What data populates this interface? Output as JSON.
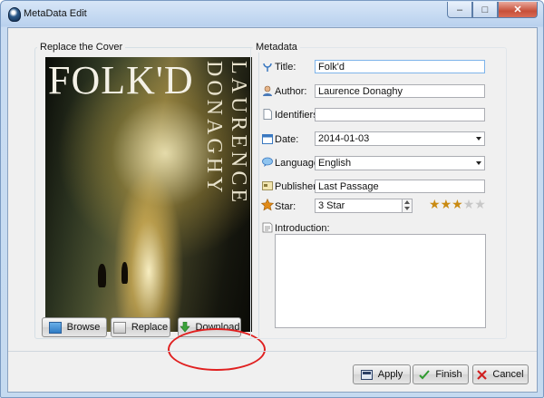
{
  "window": {
    "title": "MetaData Edit"
  },
  "cover_panel": {
    "label": "Replace the Cover",
    "cover": {
      "title": "FOLK'D",
      "author": "LAURENCE DONAGHY"
    },
    "buttons": {
      "browse": "Browse",
      "replace": "Replace",
      "download": "Download"
    }
  },
  "metadata": {
    "label": "Metadata",
    "title": {
      "label": "Title:",
      "value": "Folk'd"
    },
    "author": {
      "label": "Author:",
      "value": "Laurence Donaghy"
    },
    "identifiers": {
      "label": "Identifiers:",
      "value": ""
    },
    "date": {
      "label": "Date:",
      "value": "2014-01-03"
    },
    "language": {
      "label": "Language:",
      "value": "English"
    },
    "publishers": {
      "label": "Publishers",
      "value": "Last Passage"
    },
    "star": {
      "label": "Star:",
      "value": "3 Star",
      "rating": 3,
      "max": 5
    },
    "introduction": {
      "label": "Introduction:",
      "value": ""
    }
  },
  "footer": {
    "apply": "Apply",
    "finish": "Finish",
    "cancel": "Cancel"
  },
  "colors": {
    "accent_red": "#e02020",
    "star_gold": "#c98a12",
    "star_empty": "#c8c8c8"
  }
}
